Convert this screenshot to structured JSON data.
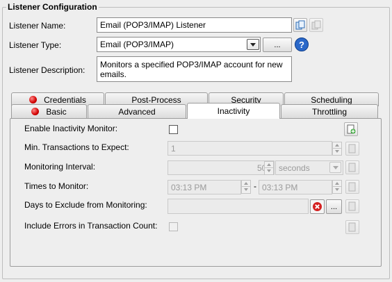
{
  "group_title": "Listener Configuration",
  "fields": {
    "name_label": "Listener Name:",
    "name_value": "Email (POP3/IMAP) Listener",
    "type_label": "Listener Type:",
    "type_value": "Email (POP3/IMAP)",
    "type_browse_label": "...",
    "help_label": "?",
    "desc_label": "Listener Description:",
    "desc_value": "Monitors a specified POP3/IMAP account for new emails."
  },
  "tabs": {
    "row1": [
      "Credentials",
      "Post-Process",
      "Security",
      "Scheduling"
    ],
    "row2": [
      "Basic",
      "Advanced",
      "Inactivity",
      "Throttling"
    ],
    "active": "Inactivity"
  },
  "inactivity": {
    "enable_label": "Enable Inactivity Monitor:",
    "min_tx_label": "Min. Transactions to Expect:",
    "min_tx_value": "1",
    "interval_label": "Monitoring Interval:",
    "interval_value": "500",
    "interval_unit": "seconds",
    "times_label": "Times to Monitor:",
    "time_from": "03:13 PM",
    "time_sep": "-",
    "time_to": "03:13 PM",
    "days_label": "Days to Exclude from Monitoring:",
    "days_browse": "...",
    "errors_label": "Include Errors in Transaction Count:"
  }
}
